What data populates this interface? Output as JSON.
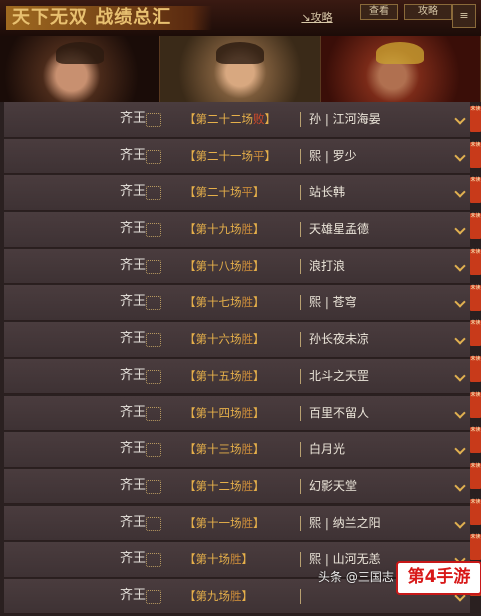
{
  "header": {
    "title": "天下无双 战绩总汇",
    "guide_label": "↘攻略",
    "button_a": "查看",
    "button_b": "攻略",
    "button_c": "≡"
  },
  "side_tag_label": "未读",
  "rows": [
    {
      "title": "齐王",
      "match": "【第二十二场",
      "result": "败",
      "pending": true,
      "opponent": "孙 | 江河海晏"
    },
    {
      "title": "齐王",
      "match": "【第二十一场",
      "result": "平",
      "pending": false,
      "opponent": "熙 | 罗少"
    },
    {
      "title": "齐王",
      "match": "【第二十场",
      "result": "平",
      "pending": false,
      "opponent": "站长韩"
    },
    {
      "title": "齐王",
      "match": "【第十九场",
      "result": "胜",
      "pending": false,
      "opponent": "天雄星孟德"
    },
    {
      "title": "齐王",
      "match": "【第十八场",
      "result": "胜",
      "pending": false,
      "opponent": "浪打浪"
    },
    {
      "title": "齐王",
      "match": "【第十七场",
      "result": "胜",
      "pending": false,
      "opponent": "熙 | 苍穹"
    },
    {
      "title": "齐王",
      "match": "【第十六场",
      "result": "胜",
      "pending": false,
      "opponent": "孙长夜未凉"
    },
    {
      "title": "齐王",
      "match": "【第十五场",
      "result": "胜",
      "pending": false,
      "opponent": "北斗之天罡"
    },
    {
      "title": "齐王",
      "match": "【第十四场",
      "result": "胜",
      "pending": false,
      "opponent": "百里不留人"
    },
    {
      "title": "齐王",
      "match": "【第十三场",
      "result": "胜",
      "pending": false,
      "opponent": "白月光"
    },
    {
      "title": "齐王",
      "match": "【第十二场",
      "result": "胜",
      "pending": false,
      "opponent": "幻影天堂"
    },
    {
      "title": "齐王",
      "match": "【第十一场",
      "result": "胜",
      "pending": false,
      "opponent": "熙 | 纳兰之阳"
    },
    {
      "title": "齐王",
      "match": "【第十场",
      "result": "胜",
      "pending": false,
      "opponent": "熙 | 山河无恙"
    },
    {
      "title": "齐王",
      "match": "【第九场",
      "result": "胜",
      "pending": false,
      "opponent": ""
    }
  ],
  "watermark": {
    "text": "头条 @三国志",
    "logo": "第4手游"
  },
  "colors": {
    "row_bg": "#443638",
    "match_gold": "#e6b04a",
    "pending_red": "#d04a2a",
    "chevron": "#e0b050"
  }
}
